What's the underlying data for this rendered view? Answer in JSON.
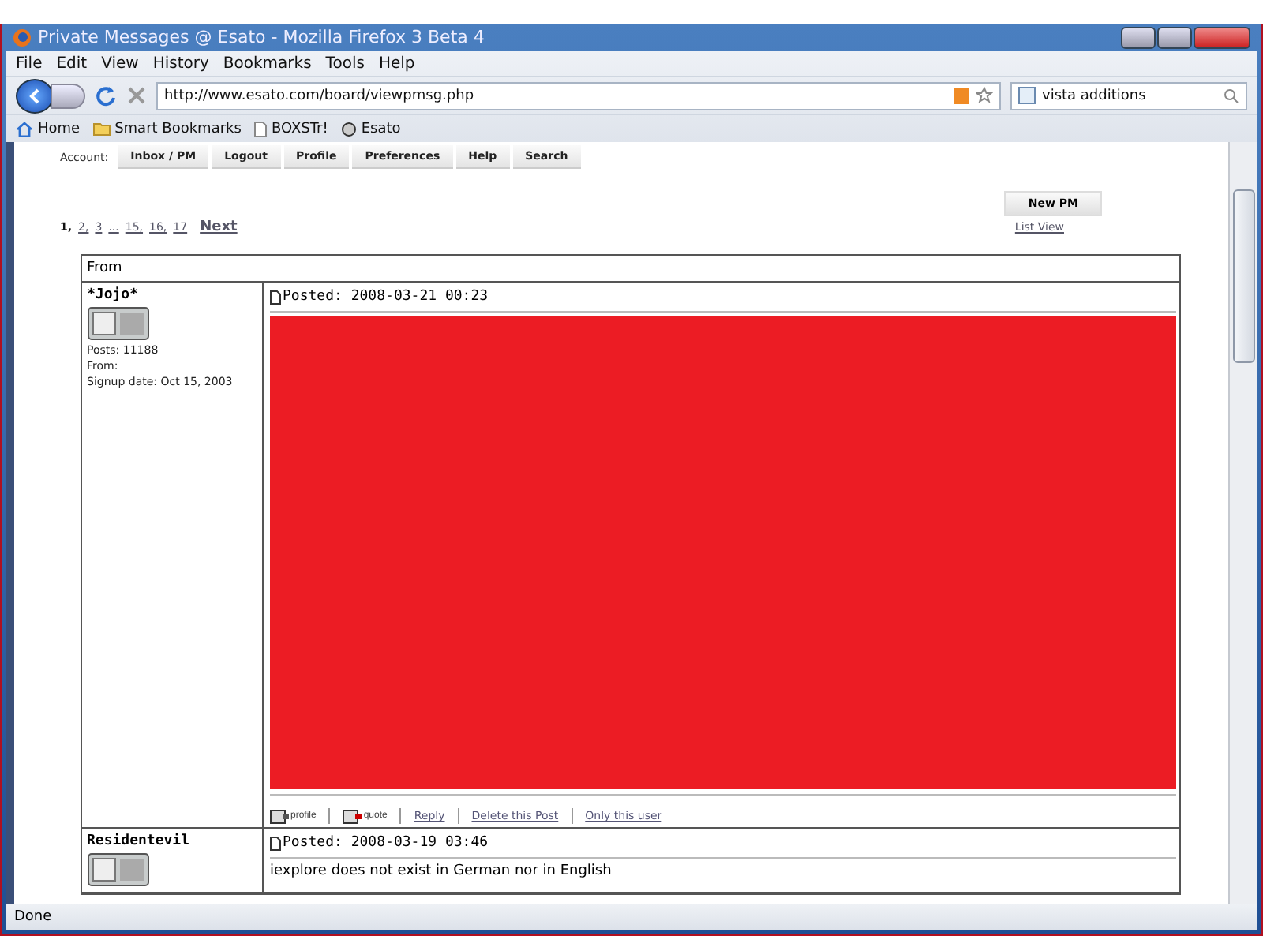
{
  "window": {
    "title": "Private Messages @ Esato - Mozilla Firefox 3 Beta 4"
  },
  "menu": [
    "File",
    "Edit",
    "View",
    "History",
    "Bookmarks",
    "Tools",
    "Help"
  ],
  "address": {
    "value": "http://www.esato.com/board/viewpmsg.php"
  },
  "search": {
    "value": "vista additions"
  },
  "bookmarks": [
    {
      "label": "Home",
      "kind": "home"
    },
    {
      "label": "Smart Bookmarks",
      "kind": "folder"
    },
    {
      "label": "BOXSTr!",
      "kind": "page"
    },
    {
      "label": "Esato",
      "kind": "site"
    }
  ],
  "account": {
    "label": "Account:",
    "buttons": [
      "Inbox / PM",
      "Logout",
      "Profile",
      "Preferences",
      "Help",
      "Search"
    ]
  },
  "new_pm": "New PM",
  "pagination": {
    "pages": [
      {
        "label": "1,",
        "selected": true
      },
      {
        "label": "2,",
        "selected": false
      },
      {
        "label": "3",
        "selected": false
      },
      {
        "label": "...",
        "selected": false
      },
      {
        "label": "15,",
        "selected": false
      },
      {
        "label": "16,",
        "selected": false
      },
      {
        "label": "17",
        "selected": false
      }
    ],
    "next": "Next"
  },
  "list_view": "List View",
  "table": {
    "header": "From",
    "posts": [
      {
        "author": "*Jojo*",
        "stats": [
          "Posts: 11188",
          "From:",
          "Signup date: Oct 15, 2003"
        ],
        "posted": "Posted: 2008-03-21 00:23",
        "redacted": true,
        "actions": [
          "profile",
          "quote"
        ],
        "links": [
          "Reply",
          "Delete this Post",
          "Only this user"
        ]
      },
      {
        "author": "Residentevil",
        "posted": "Posted: 2008-03-19 03:46",
        "body": "iexplore does not exist in German nor in English"
      }
    ]
  },
  "status_bar": "Done"
}
